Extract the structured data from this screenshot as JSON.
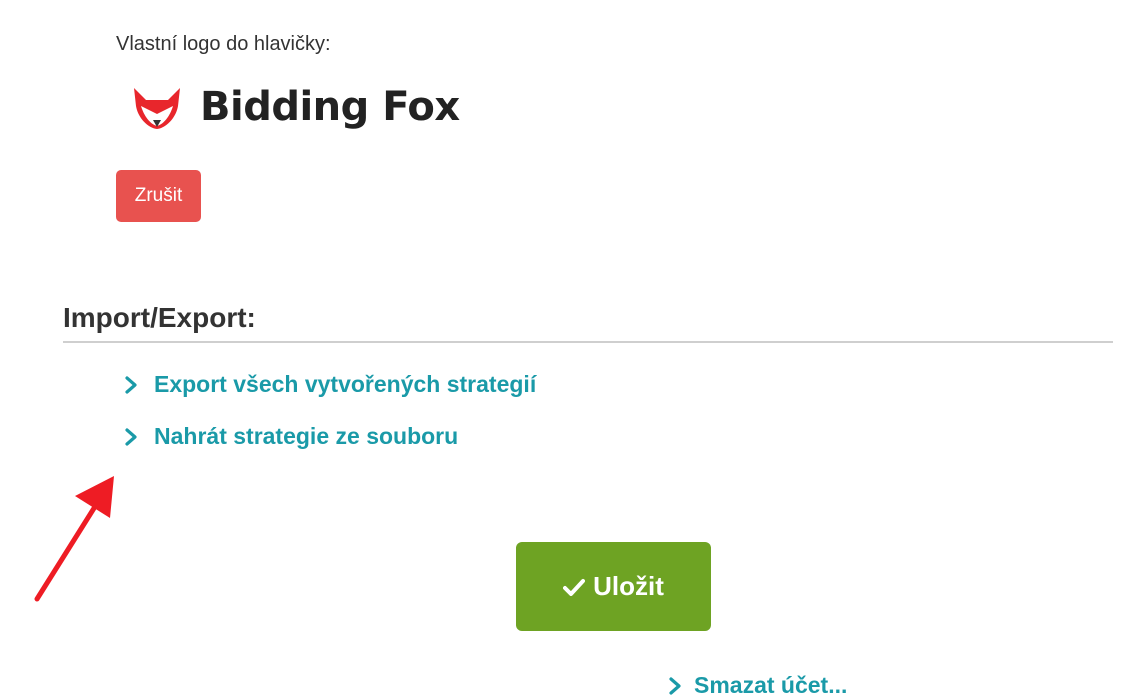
{
  "logo_section": {
    "label": "Vlastní logo do hlavičky:",
    "logo_text": "Bidding Fox",
    "cancel_label": "Zrušit"
  },
  "import_export": {
    "title": "Import/Export:",
    "links": [
      {
        "label": "Export všech vytvořených strategií"
      },
      {
        "label": "Nahrát strategie ze souboru"
      }
    ]
  },
  "footer": {
    "save_label": "Uložit",
    "bottom_link_label": "Smazat účet..."
  },
  "colors": {
    "accent_link": "#1a9aa8",
    "save_button": "#6ea323",
    "cancel_button": "#e8524f",
    "annotation_arrow": "#ee1c24"
  }
}
